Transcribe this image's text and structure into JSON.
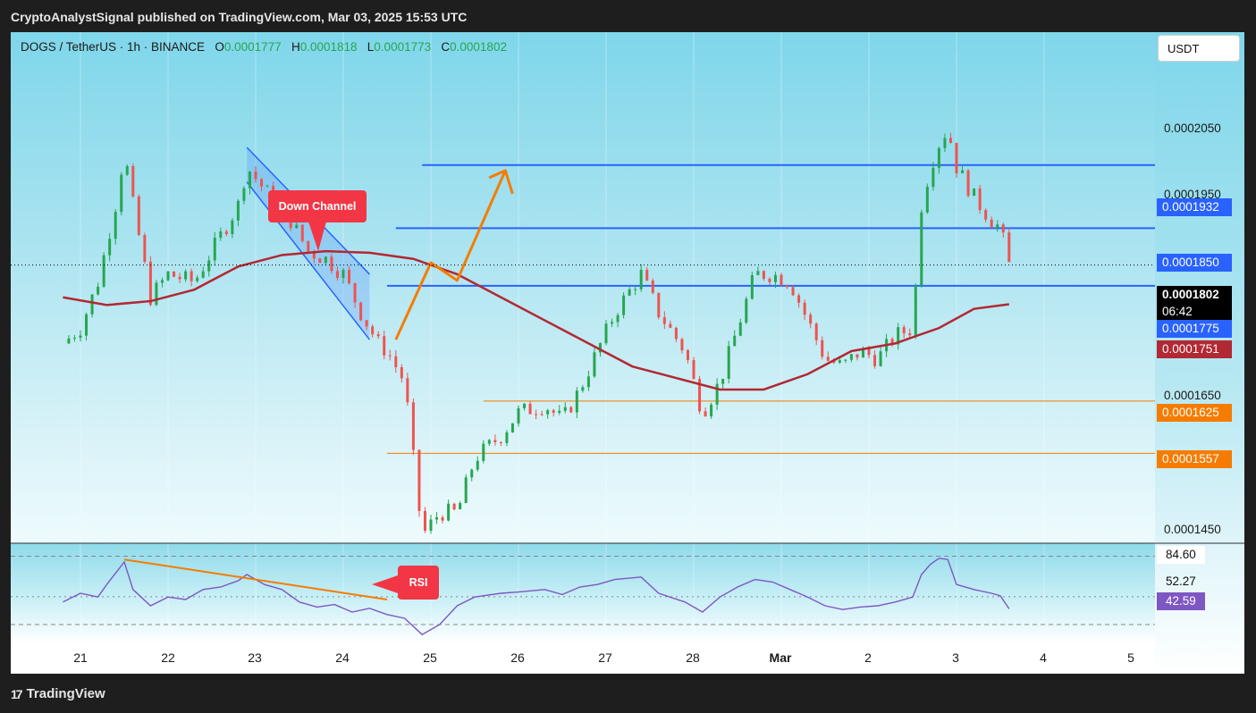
{
  "header": {
    "title": "CryptoAnalystSignal published on TradingView.com, Mar 03, 2025 15:53 UTC"
  },
  "legend": {
    "symbol": "DOGS / TetherUS · 1h · BINANCE",
    "o_label": "O",
    "o": "0.0001777",
    "h_label": "H",
    "h": "0.0001818",
    "l_label": "L",
    "l": "0.0001773",
    "c_label": "C",
    "c": "0.0001802"
  },
  "currency_button": "USDT",
  "price_axis": {
    "ticks": [
      "0.0002050",
      "0.0001950",
      "0.0001650",
      "0.0001450"
    ],
    "labels": [
      {
        "text": "0.0001932",
        "color": "#2962ff"
      },
      {
        "text": "0.0001850",
        "color": "#2962ff"
      },
      {
        "text": "0.0001775",
        "color": "#2962ff"
      },
      {
        "text": "0.0001751",
        "color": "#b22833"
      },
      {
        "text": "0.0001625",
        "color": "#f57c00"
      },
      {
        "text": "0.0001557",
        "color": "#f57c00"
      }
    ],
    "last_price": "0.0001802",
    "countdown": "06:42"
  },
  "rsi_axis": {
    "upper": "84.60",
    "mid": "52.27",
    "value": "42.59"
  },
  "x_axis": [
    "21",
    "22",
    "23",
    "24",
    "25",
    "26",
    "27",
    "28",
    "Mar",
    "2",
    "3",
    "4",
    "5"
  ],
  "annotations": {
    "down_channel": "Down Channel",
    "rsi": "RSI"
  },
  "footer": {
    "brand": "TradingView"
  },
  "colors": {
    "up": "#26a650",
    "down": "#ef5350",
    "ma": "#b22833",
    "level_blue": "#2962ff",
    "level_orange": "#f57c00"
  },
  "chart_data": {
    "type": "candlestick",
    "symbol": "DOGS / TetherUS",
    "interval": "1h",
    "ylim": [
      0.000144,
      0.0002105
    ],
    "x_days": [
      "21",
      "22",
      "23",
      "24",
      "25",
      "26",
      "27",
      "28",
      "Mar",
      "2",
      "3",
      "4",
      "5"
    ],
    "close_path": [
      [
        20.8,
        0.00017
      ],
      [
        21.0,
        0.000172
      ],
      [
        21.2,
        0.000178
      ],
      [
        21.4,
        0.000188
      ],
      [
        21.5,
        0.000195
      ],
      [
        21.6,
        0.000188
      ],
      [
        21.8,
        0.000176
      ],
      [
        22.0,
        0.000179
      ],
      [
        22.3,
        0.000178
      ],
      [
        22.6,
        0.000184
      ],
      [
        22.8,
        0.000188
      ],
      [
        22.9,
        0.000193
      ],
      [
        23.1,
        0.00019
      ],
      [
        23.4,
        0.000186
      ],
      [
        23.6,
        0.000182
      ],
      [
        23.8,
        0.000181
      ],
      [
        24.0,
        0.000179
      ],
      [
        24.2,
        0.000174
      ],
      [
        24.4,
        0.00017
      ],
      [
        24.5,
        0.000169
      ],
      [
        24.7,
        0.000165
      ],
      [
        24.9,
        0.000145
      ],
      [
        25.1,
        0.000148
      ],
      [
        25.3,
        0.000148
      ],
      [
        25.5,
        0.000155
      ],
      [
        25.8,
        0.000158
      ],
      [
        26.0,
        0.000161
      ],
      [
        26.3,
        0.000162
      ],
      [
        26.5,
        0.00016
      ],
      [
        26.7,
        0.000164
      ],
      [
        26.9,
        0.000169
      ],
      [
        27.1,
        0.000174
      ],
      [
        27.4,
        0.000179
      ],
      [
        27.6,
        0.000174
      ],
      [
        27.9,
        0.000169
      ],
      [
        28.1,
        0.000161
      ],
      [
        28.3,
        0.000165
      ],
      [
        28.5,
        0.000172
      ],
      [
        28.7,
        0.000179
      ],
      [
        28.9,
        0.000179
      ],
      [
        29.1,
        0.000178
      ],
      [
        29.3,
        0.000173
      ],
      [
        29.5,
        0.000168
      ],
      [
        29.7,
        0.000167
      ],
      [
        29.9,
        0.000169
      ],
      [
        30.1,
        0.000168
      ],
      [
        30.3,
        0.000171
      ],
      [
        30.5,
        0.000172
      ],
      [
        30.6,
        0.000188
      ],
      [
        30.7,
        0.000193
      ],
      [
        30.8,
        0.000196
      ],
      [
        30.9,
        0.000198
      ],
      [
        31.0,
        0.000193
      ],
      [
        31.2,
        0.000189
      ],
      [
        31.4,
        0.000186
      ],
      [
        31.5,
        0.000185
      ],
      [
        31.6,
        0.0001802
      ]
    ],
    "ma_path": [
      [
        20.8,
        0.000176
      ],
      [
        21.3,
        0.000175
      ],
      [
        21.8,
        0.0001755
      ],
      [
        22.3,
        0.000177
      ],
      [
        22.8,
        0.00018
      ],
      [
        23.3,
        0.0001815
      ],
      [
        23.8,
        0.000182
      ],
      [
        24.3,
        0.0001818
      ],
      [
        24.8,
        0.000181
      ],
      [
        25.3,
        0.000179
      ],
      [
        25.8,
        0.000176
      ],
      [
        26.3,
        0.000173
      ],
      [
        26.8,
        0.00017
      ],
      [
        27.3,
        0.000167
      ],
      [
        27.8,
        0.0001655
      ],
      [
        28.3,
        0.000164
      ],
      [
        28.8,
        0.000164
      ],
      [
        29.3,
        0.000166
      ],
      [
        29.8,
        0.000169
      ],
      [
        30.3,
        0.00017
      ],
      [
        30.8,
        0.000172
      ],
      [
        31.2,
        0.0001745
      ],
      [
        31.6,
        0.0001751
      ]
    ],
    "levels": [
      {
        "value": 0.0001932,
        "color": "#2962ff",
        "from": 24.9
      },
      {
        "value": 0.000185,
        "color": "#2962ff",
        "from": 24.6
      },
      {
        "value": 0.0001775,
        "color": "#2962ff",
        "from": 24.5
      },
      {
        "value": 0.0001625,
        "color": "#f57c00",
        "from": 25.6
      },
      {
        "value": 0.0001557,
        "color": "#f57c00",
        "from": 24.5
      }
    ],
    "down_channel": {
      "upper": [
        [
          22.9,
          0.0001955
        ],
        [
          24.3,
          0.000179
        ]
      ],
      "lower": [
        [
          22.9,
          0.000191
        ],
        [
          24.3,
          0.0001705
        ]
      ]
    },
    "projection_arrow": [
      [
        24.6,
        0.0001705
      ],
      [
        25.0,
        0.0001805
      ],
      [
        25.3,
        0.0001782
      ],
      [
        25.85,
        0.0001925
      ]
    ],
    "rsi": {
      "ylim": [
        15,
        95
      ],
      "upper_band": 84.6,
      "mid": 52.27,
      "last": 42.59,
      "series": [
        [
          20.8,
          48
        ],
        [
          21.0,
          55
        ],
        [
          21.2,
          52
        ],
        [
          21.3,
          62
        ],
        [
          21.5,
          80
        ],
        [
          21.6,
          58
        ],
        [
          21.8,
          45
        ],
        [
          22.0,
          52
        ],
        [
          22.2,
          50
        ],
        [
          22.4,
          58
        ],
        [
          22.6,
          60
        ],
        [
          22.8,
          65
        ],
        [
          22.9,
          70
        ],
        [
          23.1,
          62
        ],
        [
          23.3,
          58
        ],
        [
          23.5,
          48
        ],
        [
          23.7,
          44
        ],
        [
          23.9,
          46
        ],
        [
          24.1,
          40
        ],
        [
          24.3,
          43
        ],
        [
          24.5,
          38
        ],
        [
          24.7,
          35
        ],
        [
          24.9,
          22
        ],
        [
          25.1,
          30
        ],
        [
          25.3,
          45
        ],
        [
          25.5,
          52
        ],
        [
          25.8,
          55
        ],
        [
          26.0,
          56
        ],
        [
          26.3,
          58
        ],
        [
          26.5,
          54
        ],
        [
          26.7,
          60
        ],
        [
          26.9,
          62
        ],
        [
          27.1,
          66
        ],
        [
          27.4,
          68
        ],
        [
          27.6,
          55
        ],
        [
          27.9,
          48
        ],
        [
          28.1,
          40
        ],
        [
          28.3,
          52
        ],
        [
          28.5,
          60
        ],
        [
          28.7,
          66
        ],
        [
          28.9,
          64
        ],
        [
          29.1,
          58
        ],
        [
          29.3,
          52
        ],
        [
          29.5,
          45
        ],
        [
          29.7,
          42
        ],
        [
          29.9,
          44
        ],
        [
          30.1,
          45
        ],
        [
          30.3,
          48
        ],
        [
          30.5,
          52
        ],
        [
          30.6,
          70
        ],
        [
          30.7,
          78
        ],
        [
          30.8,
          83
        ],
        [
          30.9,
          82
        ],
        [
          31.0,
          62
        ],
        [
          31.2,
          58
        ],
        [
          31.4,
          55
        ],
        [
          31.5,
          53
        ],
        [
          31.6,
          42.59
        ]
      ]
    }
  }
}
